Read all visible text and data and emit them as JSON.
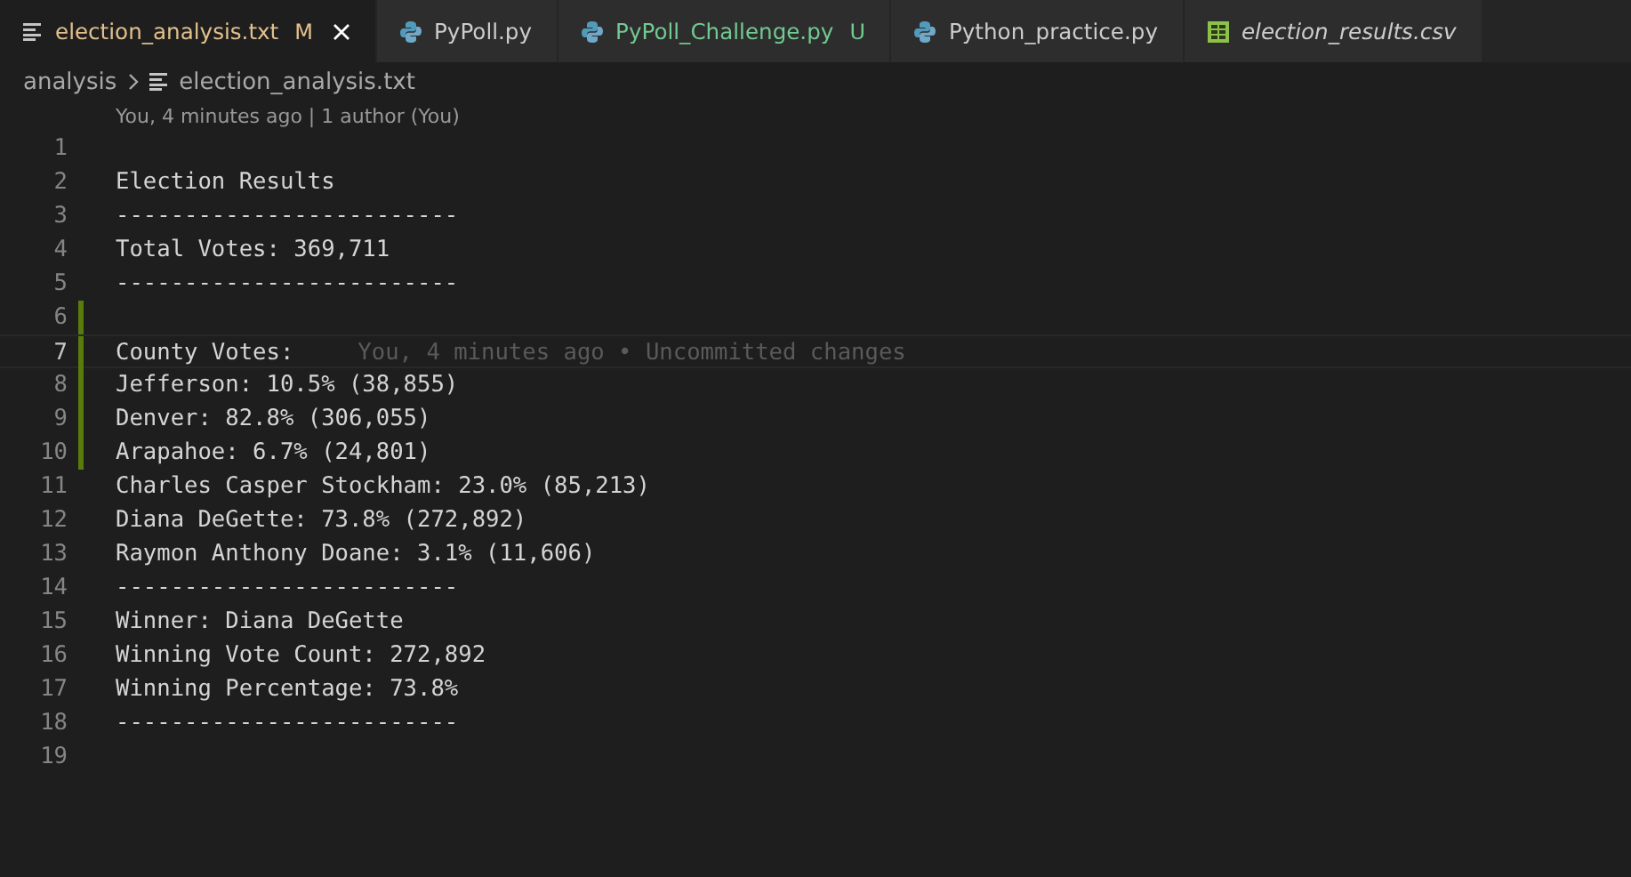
{
  "tabs": [
    {
      "label": "election_analysis.txt",
      "kind": "text",
      "status": "M",
      "color": "#e2c08d",
      "selected": true,
      "preview": false
    },
    {
      "label": "PyPoll.py",
      "kind": "python",
      "color": "#cccccc",
      "selected": false,
      "preview": false
    },
    {
      "label": "PyPoll_Challenge.py",
      "kind": "python",
      "status": "U",
      "color": "#73c991",
      "selected": false,
      "preview": false
    },
    {
      "label": "Python_practice.py",
      "kind": "python",
      "color": "#cccccc",
      "selected": false,
      "preview": false
    },
    {
      "label": "election_results.csv",
      "kind": "csv",
      "color": "#cccccc",
      "selected": false,
      "preview": true
    }
  ],
  "breadcrumb": {
    "folder": "analysis",
    "file": "election_analysis.txt"
  },
  "codelens": "You, 4 minutes ago | 1 author (You)",
  "lines": [
    {
      "number": "1",
      "modified": false,
      "current": false
    },
    {
      "number": "2",
      "text": "Election Results",
      "modified": false,
      "current": false
    },
    {
      "number": "3",
      "text": "-------------------------",
      "modified": false,
      "current": false
    },
    {
      "number": "4",
      "text": "Total Votes: 369,711",
      "modified": false,
      "current": false
    },
    {
      "number": "5",
      "text": "-------------------------",
      "modified": false,
      "current": false
    },
    {
      "number": "6",
      "modified": true,
      "current": false
    },
    {
      "number": "7",
      "text": "County Votes:",
      "modified": true,
      "current": true,
      "blame": "You, 4 minutes ago • Uncommitted changes"
    },
    {
      "number": "8",
      "text": "Jefferson: 10.5% (38,855)",
      "modified": true,
      "current": false
    },
    {
      "number": "9",
      "text": "Denver: 82.8% (306,055)",
      "modified": true,
      "current": false
    },
    {
      "number": "10",
      "text": "Arapahoe: 6.7% (24,801)",
      "modified": true,
      "current": false
    },
    {
      "number": "11",
      "text": "Charles Casper Stockham: 23.0% (85,213)",
      "modified": false,
      "current": false
    },
    {
      "number": "12",
      "text": "Diana DeGette: 73.8% (272,892)",
      "modified": false,
      "current": false
    },
    {
      "number": "13",
      "text": "Raymon Anthony Doane: 3.1% (11,606)",
      "modified": false,
      "current": false
    },
    {
      "number": "14",
      "text": "-------------------------",
      "modified": false,
      "current": false
    },
    {
      "number": "15",
      "text": "Winner: Diana DeGette",
      "modified": false,
      "current": false
    },
    {
      "number": "16",
      "text": "Winning Vote Count: 272,892",
      "modified": false,
      "current": false
    },
    {
      "number": "17",
      "text": "Winning Percentage: 73.8%",
      "modified": false,
      "current": false
    },
    {
      "number": "18",
      "text": "-------------------------",
      "modified": false,
      "current": false
    },
    {
      "number": "19",
      "modified": false,
      "current": false
    }
  ]
}
